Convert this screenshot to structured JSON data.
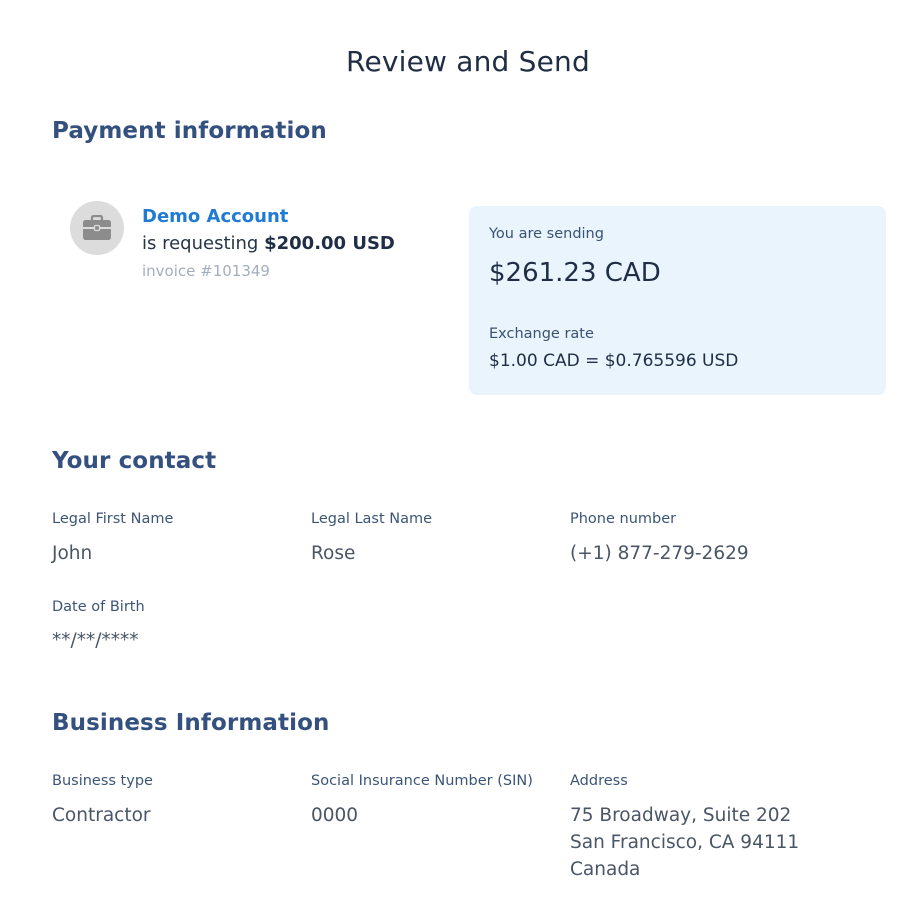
{
  "page": {
    "title": "Review and Send"
  },
  "payment": {
    "section_title": "Payment information",
    "merchant": {
      "icon": "briefcase-icon",
      "name": "Demo Account",
      "request_prefix": "is requesting",
      "request_amount": "$200.00 USD",
      "invoice": "invoice #101349"
    },
    "summary": {
      "sending_label": "You are sending",
      "sending_amount": "$261.23 CAD",
      "rate_label": "Exchange rate",
      "rate_value": "$1.00 CAD = $0.765596 USD"
    }
  },
  "contact": {
    "section_title": "Your contact",
    "fields": [
      {
        "label": "Legal First Name",
        "value": "John"
      },
      {
        "label": "Legal Last Name",
        "value": "Rose"
      },
      {
        "label": "Phone number",
        "value": "(+1) 877-279-2629"
      },
      {
        "label": "Date of Birth",
        "value": "**/**/****"
      }
    ]
  },
  "business": {
    "section_title": "Business Information",
    "fields": [
      {
        "label": "Business type",
        "value": "Contractor"
      },
      {
        "label": "Social Insurance Number (SIN)",
        "value": "0000"
      },
      {
        "label": "Address",
        "lines": [
          "75 Broadway, Suite 202",
          "San Francisco, CA 94111",
          "Canada"
        ]
      }
    ]
  },
  "colors": {
    "accent": "#1f7bd3",
    "section_heading": "#33507e",
    "card_background": "#eaf4fd"
  }
}
